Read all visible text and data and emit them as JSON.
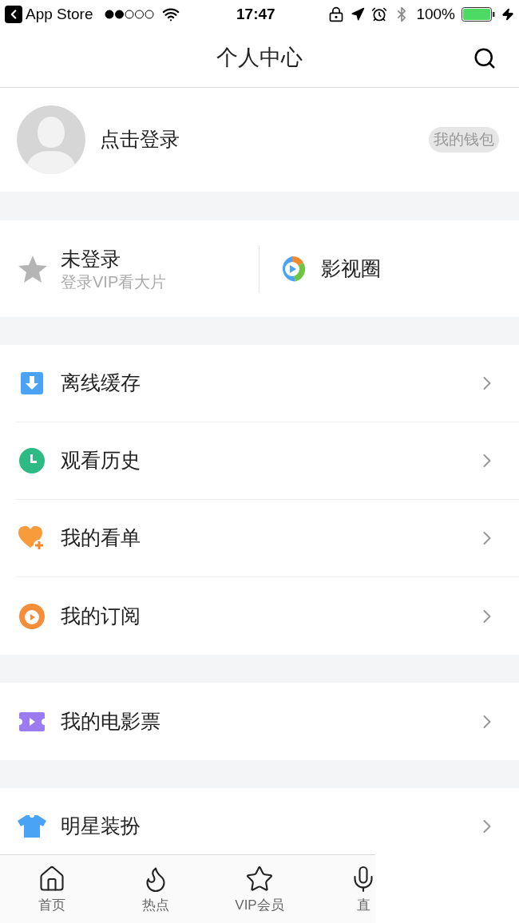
{
  "status_bar": {
    "back_app": "App Store",
    "time": "17:47",
    "battery": "100%"
  },
  "nav": {
    "title": "个人中心"
  },
  "profile": {
    "login": "点击登录",
    "wallet": "我的钱包"
  },
  "vip": {
    "title": "未登录",
    "subtitle": "登录VIP看大片",
    "circle": "影视圈"
  },
  "sections": [
    [
      {
        "label": "离线缓存",
        "kind": "download"
      },
      {
        "label": "观看历史",
        "kind": "history"
      },
      {
        "label": "我的看单",
        "kind": "watchlist"
      },
      {
        "label": "我的订阅",
        "kind": "subscribe"
      }
    ],
    [
      {
        "label": "我的电影票",
        "kind": "ticket"
      }
    ],
    [
      {
        "label": "明星装扮",
        "kind": "shirt"
      }
    ]
  ],
  "tab_bar": [
    {
      "label": "首页",
      "kind": "home"
    },
    {
      "label": "热点",
      "kind": "hot"
    },
    {
      "label": "VIP会员",
      "kind": "vip"
    },
    {
      "label": "直",
      "kind": "live"
    }
  ]
}
